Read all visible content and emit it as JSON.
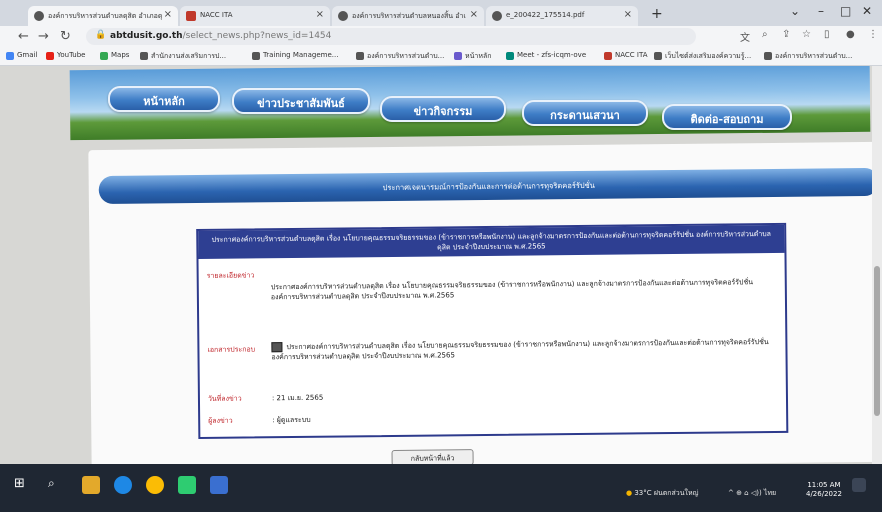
{
  "browser": {
    "tabs": [
      {
        "title": "องค์การบริหารส่วนตำบลดุสิต อำเภอดุ",
        "active": true
      },
      {
        "title": "NACC ITA",
        "active": false
      },
      {
        "title": "องค์การบริหารส่วนตำบลหนองสิ้น อำเ",
        "active": false
      },
      {
        "title": "e_200422_175514.pdf",
        "active": false
      }
    ],
    "new_tab": "+",
    "window_controls": {
      "chevron": "⌄",
      "minimize": "–",
      "maximize": "□",
      "close": "✕"
    },
    "url_host": "abtdusit.go.th",
    "url_path": "/select_news.php?news_id=1454",
    "bookmarks": [
      "Gmail",
      "YouTube",
      "Maps",
      "สำนักงานส่งเสริมการป...",
      "Training Manageme...",
      "องค์การบริหารส่วนตำบ...",
      "หน้าหลัก",
      "Meet - zfs-icqm-ove",
      "NACC ITA",
      "เว็บไซต์ส่งเสริมองค์ความรู้...",
      "องค์การบริหารส่วนตำบ..."
    ]
  },
  "site": {
    "nav": [
      "หน้าหลัก",
      "ข่าวประชาสัมพันธ์",
      "ข่าวกิจกรรม",
      "กระดานเสวนา",
      "ติดต่อ-สอบถาม"
    ],
    "section_title": "ประกาศเจตนารมณ์การป้องกันและการต่อต้านการทุจริตคอร์รัปชั่น",
    "news": {
      "header": "ประกาศองค์การบริหารส่วนตำบลดุสิต เรื่อง นโยบายคุณธรรมจริยธรรมของ (ข้าราชการหรือพนักงาน) และลูกจ้างมาตรการป้องกันและต่อต้านการทุจริตคอร์รัปชั่น องค์การบริหารส่วนตำบลดุสิต ประจำปีงบประมาณ พ.ศ.2565",
      "detail_label": "รายละเอียดข่าว",
      "detail_text": "ประกาศองค์การบริหารส่วนตำบลดุสิต เรื่อง นโยบายคุณธรรมจริยธรรมของ (ข้าราชการหรือพนักงาน) และลูกจ้างมาตรการป้องกันและต่อต้านการทุจริตคอร์รัปชั่น องค์การบริหารส่วนตำบลดุสิต ประจำปีงบประมาณ พ.ศ.2565",
      "attachment_label": "เอกสารประกอบ",
      "attachment_text": "ประกาศองค์การบริหารส่วนตำบลดุสิต เรื่อง นโยบายคุณธรรมจริยธรรมของ (ข้าราชการหรือพนักงาน) และลูกจ้างมาตรการป้องกันและต่อต้านการทุจริตคอร์รัปชั่น องค์การบริหารส่วนตำบลดุสิต ประจำปีงบประมาณ พ.ศ.2565",
      "date_label": "วันที่ลงข่าว",
      "date_value": ": 21 เม.ย. 2565",
      "author_label": "ผู้ลงข่าว",
      "author_value": ": ผู้ดูแลระบบ"
    },
    "back_button": "กลับหน้าที่แล้ว"
  },
  "taskbar": {
    "weather": "33°C ฝนตกส่วนใหญ่",
    "tray_symbols": "^ ⊕ ⌂ ◁)) ไทย",
    "time": "11:05 AM",
    "date": "4/26/2022"
  }
}
